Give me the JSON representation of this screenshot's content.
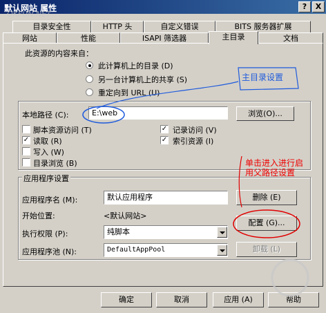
{
  "window": {
    "title": "默认网站 属性",
    "help_button": "?",
    "close_button": "X",
    "watermark": "OKFUN.NET"
  },
  "tabs": {
    "row1": [
      "目录安全性",
      "HTTP 头",
      "自定义错误",
      "BITS 服务器扩展"
    ],
    "row2": [
      "网站",
      "性能",
      "ISAPI 筛选器",
      "主目录",
      "文档"
    ],
    "active": "主目录"
  },
  "content_source": {
    "label": "此资源的内容来自：",
    "options": [
      {
        "label": "此计算机上的目录 (D)",
        "selected": true
      },
      {
        "label": "另一台计算机上的共享 (S)",
        "selected": false
      },
      {
        "label": "重定向到 URL (U)",
        "selected": false
      }
    ]
  },
  "local_path": {
    "label": "本地路径 (C):",
    "value": "E:\\web",
    "browse_button": "浏览(O)..."
  },
  "permissions": {
    "left": [
      {
        "label": "脚本资源访问 (T)",
        "checked": false
      },
      {
        "label": "读取 (R)",
        "checked": true
      },
      {
        "label": "写入 (W)",
        "checked": false
      },
      {
        "label": "目录浏览 (B)",
        "checked": false
      }
    ],
    "right": [
      {
        "label": "记录访问 (V)",
        "checked": true
      },
      {
        "label": "索引资源 (I)",
        "checked": true
      }
    ]
  },
  "app_settings": {
    "section_label": "应用程序设置",
    "app_name_label": "应用程序名 (M):",
    "app_name_value": "默认应用程序",
    "remove_button": "删除 (E)",
    "start_point_label": "开始位置:",
    "start_point_value": "<默认网站>",
    "config_button": "配置 (G)...",
    "exec_perm_label": "执行权限 (P):",
    "exec_perm_value": "纯脚本",
    "app_pool_label": "应用程序池 (N):",
    "app_pool_value": "DefaultAppPool",
    "unload_button": "卸载 (L)"
  },
  "footer": {
    "ok": "确定",
    "cancel": "取消",
    "apply": "应用 (A)",
    "help": "帮助"
  },
  "annotations": {
    "home_dir": "主目录设置",
    "parent_path_line1": "单击进入进行启",
    "parent_path_line2": "用父路径设置"
  },
  "colors": {
    "titlebar": "#0a246a",
    "face": "#d4d0c8",
    "annotation_blue": "#1e5adc",
    "annotation_red": "#e00000"
  }
}
